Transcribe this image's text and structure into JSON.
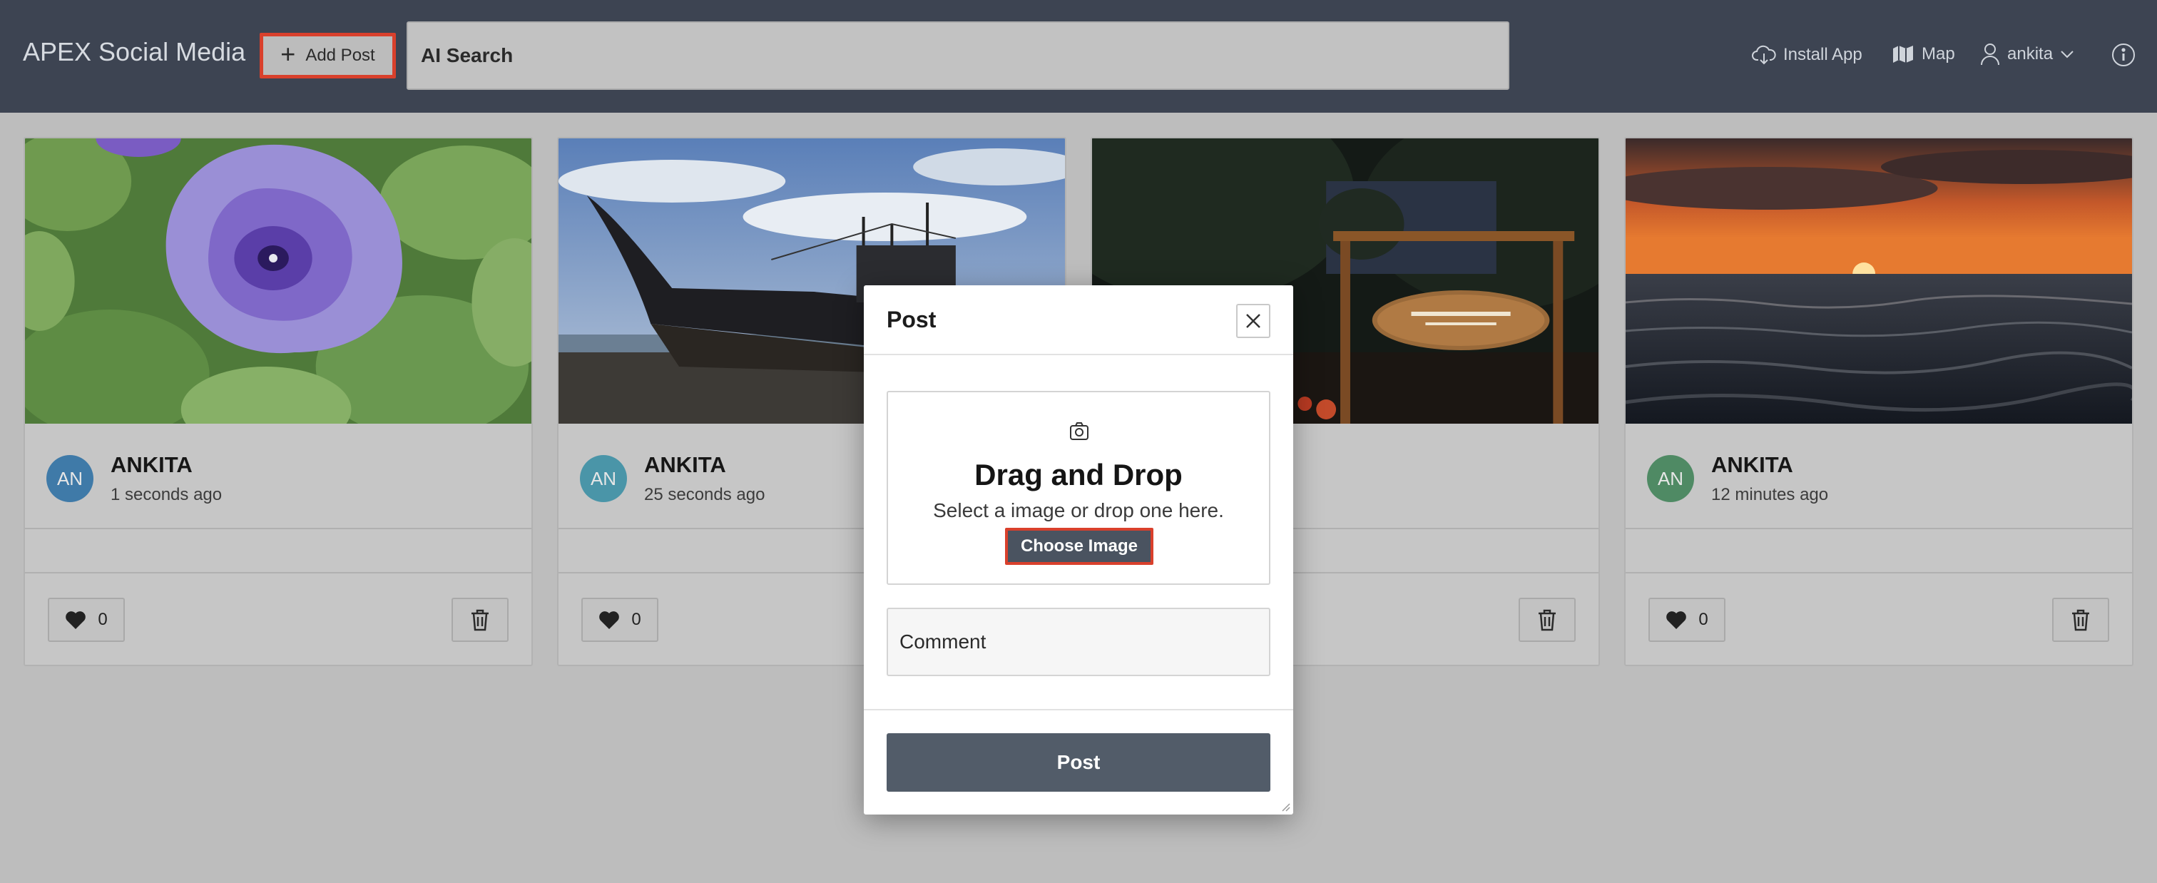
{
  "header": {
    "app_title": "APEX Social Media",
    "add_post_label": "Add Post",
    "search_placeholder": "AI Search",
    "install_label": "Install App",
    "map_label": "Map",
    "user_label": "ankita"
  },
  "cards": [
    {
      "initials": "AN",
      "name": "ANKITA",
      "time": "1 seconds ago",
      "likes": "0",
      "avatar_color": "#3f7aa8"
    },
    {
      "initials": "AN",
      "name": "ANKITA",
      "time": "25 seconds ago",
      "likes": "0",
      "avatar_color": "#4a95a8"
    },
    {
      "initials": "",
      "name": "",
      "time": "",
      "likes": "",
      "avatar_color": ""
    },
    {
      "initials": "AN",
      "name": "ANKITA",
      "time": "12 minutes ago",
      "likes": "0",
      "avatar_color": "#4f8a64"
    }
  ],
  "modal": {
    "title": "Post",
    "dropzone_title": "Drag and Drop",
    "dropzone_subtitle": "Select a image or drop one here.",
    "choose_label": "Choose Image",
    "comment_placeholder": "Comment",
    "post_label": "Post"
  },
  "colors": {
    "header_bg": "#3d4452",
    "accent_outline": "#d9402c",
    "primary_button": "#525c69"
  }
}
